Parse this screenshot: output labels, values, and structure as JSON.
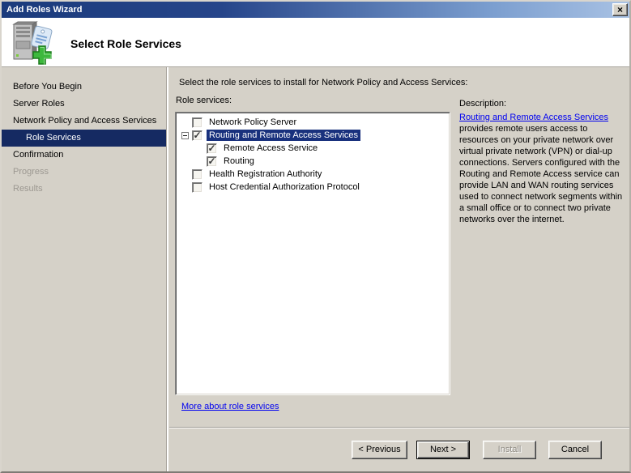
{
  "window": {
    "title": "Add Roles Wizard",
    "close_glyph": "×"
  },
  "header": {
    "title": "Select Role Services",
    "icon": "server-add-roles-icon"
  },
  "sidebar": {
    "items": [
      {
        "label": "Before You Begin",
        "state": "normal"
      },
      {
        "label": "Server Roles",
        "state": "normal"
      },
      {
        "label": "Network Policy and Access Services",
        "state": "normal"
      },
      {
        "label": "Role Services",
        "state": "active"
      },
      {
        "label": "Confirmation",
        "state": "normal"
      },
      {
        "label": "Progress",
        "state": "disabled"
      },
      {
        "label": "Results",
        "state": "disabled"
      }
    ]
  },
  "main": {
    "instruction": "Select the role services to install for Network Policy and Access Services:",
    "tree_caption": "Role services:",
    "tree": [
      {
        "label": "Network Policy Server",
        "checked": false,
        "level": 1,
        "expander": false,
        "selected": false
      },
      {
        "label": "Routing and Remote Access Services",
        "checked": true,
        "level": 1,
        "expander": true,
        "selected": true
      },
      {
        "label": "Remote Access Service",
        "checked": true,
        "level": 2,
        "expander": false,
        "selected": false
      },
      {
        "label": "Routing",
        "checked": true,
        "level": 2,
        "expander": false,
        "selected": false
      },
      {
        "label": "Health Registration Authority",
        "checked": false,
        "level": 1,
        "expander": false,
        "selected": false
      },
      {
        "label": "Host Credential Authorization Protocol",
        "checked": false,
        "level": 1,
        "expander": false,
        "selected": false
      }
    ],
    "check_glyph": "✓",
    "more_link": "More about role services"
  },
  "description": {
    "heading": "Description:",
    "link": "Routing and Remote Access Services",
    "body": "provides remote users access to resources on your private network over virtual private network (VPN) or dial-up connections. Servers configured with the Routing and Remote Access service can provide LAN and WAN routing services used to connect network segments within a small office or to connect two private networks over the internet."
  },
  "buttons": {
    "previous": "< Previous",
    "next": "Next >",
    "install": "Install",
    "cancel": "Cancel"
  },
  "colors": {
    "titlebar_left": "#1b3b7c",
    "titlebar_right": "#a9c2e4",
    "dialog_bg": "#d5d1c8",
    "sidebar_active_bg": "#152a62",
    "tree_selection_bg": "#19317d",
    "link": "#0000f0",
    "disabled_text": "#9c9891"
  }
}
